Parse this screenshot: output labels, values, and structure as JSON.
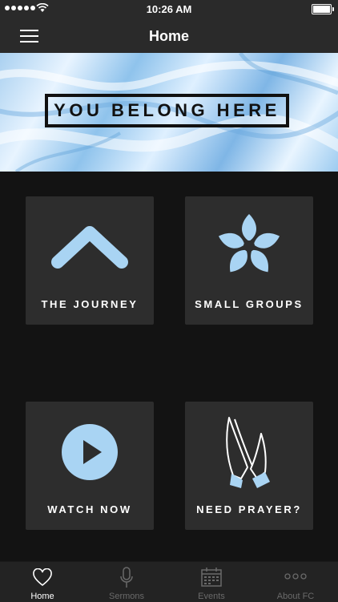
{
  "status_bar": {
    "time": "10:26 AM"
  },
  "nav": {
    "title": "Home"
  },
  "banner": {
    "text": "YOU BELONG HERE"
  },
  "tiles": [
    {
      "label": "THE JOURNEY",
      "icon": "chevron-up-icon"
    },
    {
      "label": "SMALL GROUPS",
      "icon": "hands-star-icon"
    },
    {
      "label": "WATCH NOW",
      "icon": "play-icon"
    },
    {
      "label": "NEED PRAYER?",
      "icon": "praying-hands-icon"
    }
  ],
  "tabs": [
    {
      "label": "Home",
      "icon": "heart-icon",
      "active": true
    },
    {
      "label": "Sermons",
      "icon": "microphone-icon",
      "active": false
    },
    {
      "label": "Events",
      "icon": "calendar-icon",
      "active": false
    },
    {
      "label": "About FC",
      "icon": "more-dots-icon",
      "active": false
    }
  ],
  "colors": {
    "accent": "#a9d4f3",
    "tile": "#2d2d2d",
    "background": "#131313",
    "bar": "#2a2a2a"
  }
}
